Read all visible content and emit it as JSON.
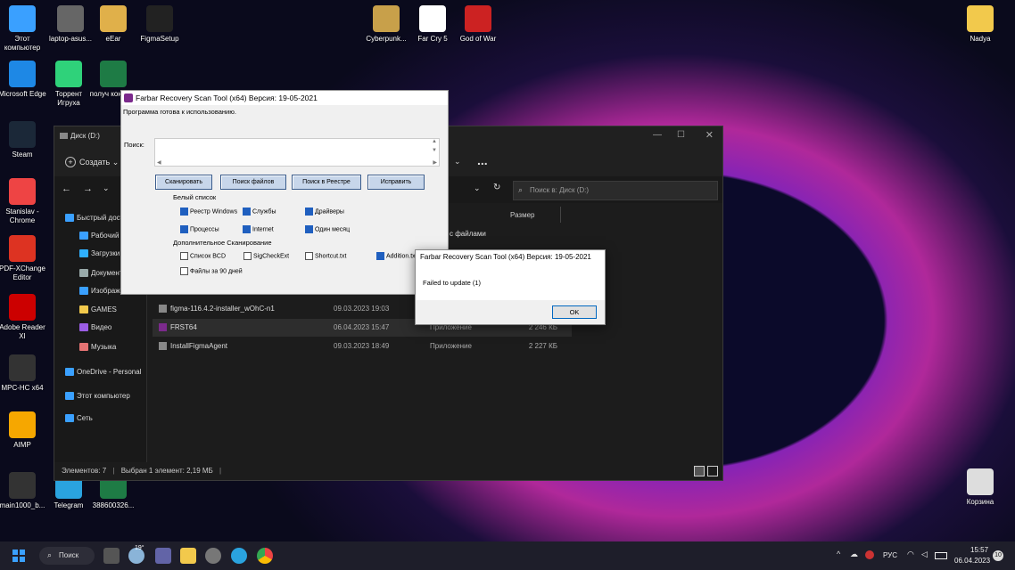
{
  "desktop": {
    "icons": [
      {
        "label": "Этот компьютер",
        "color": "#3aa0ff"
      },
      {
        "label": "laptop-asus...",
        "color": "#666"
      },
      {
        "label": "eEar",
        "color": "#e0b04a"
      },
      {
        "label": "FigmaSetup",
        "color": "#222"
      },
      {
        "label": "Cyberpunk...",
        "color": "#c8a04a"
      },
      {
        "label": "Far Cry 5",
        "color": "#fff"
      },
      {
        "label": "God of War",
        "color": "#c22"
      },
      {
        "label": "Nadya",
        "color": "#f2c94c"
      },
      {
        "label": "Microsoft Edge",
        "color": "#1e88e5"
      },
      {
        "label": "Торрент Игруха",
        "color": "#2fd27a"
      },
      {
        "label": "получ консуль",
        "color": "#1e7b45"
      },
      {
        "label": "Steam",
        "color": "#1b2838"
      },
      {
        "label": "Stanislav - Chrome",
        "color": "#e44"
      },
      {
        "label": "PDF-XChange Editor",
        "color": "#d32"
      },
      {
        "label": "Adobe Reader XI",
        "color": "#c00"
      },
      {
        "label": "MPC-HC x64",
        "color": "#333"
      },
      {
        "label": "AIMP",
        "color": "#f6a700"
      },
      {
        "label": "main1000_b...",
        "color": "#333"
      },
      {
        "label": "Telegram",
        "color": "#2aa3df"
      },
      {
        "label": "388600326...",
        "color": "#1e7b45"
      },
      {
        "label": "Корзина",
        "color": "#ddd"
      }
    ]
  },
  "explorer": {
    "title": "Диск (D:)",
    "create_label": "Создать",
    "more_label": "...",
    "search_placeholder": "Поиск в: Диск (D:)",
    "col_size": "Размер",
    "group_label": "с файлами",
    "nav": [
      {
        "label": "Быстрый доступ"
      },
      {
        "label": "Рабочий стол"
      },
      {
        "label": "Загрузки"
      },
      {
        "label": "Документы"
      },
      {
        "label": "Изображения"
      },
      {
        "label": "GAMES"
      },
      {
        "label": "Видео"
      },
      {
        "label": "Музыка"
      },
      {
        "label": "OneDrive - Personal"
      },
      {
        "label": "Этот компьютер"
      },
      {
        "label": "Сеть"
      }
    ],
    "files": [
      {
        "name": "figma-116.4.2-installer_wOhC-n1",
        "date": "09.03.2023 19:03",
        "type": "",
        "size": ""
      },
      {
        "name": "FRST64",
        "date": "06.04.2023 15:47",
        "type": "Приложение",
        "size": "2 246 КБ"
      },
      {
        "name": "InstallFigmaAgent",
        "date": "09.03.2023 18:49",
        "type": "Приложение",
        "size": "2 227 КБ"
      }
    ],
    "status_count": "Элементов: 7",
    "status_selected": "Выбран 1 элемент: 2,19 МБ"
  },
  "frst": {
    "title": "Farbar Recovery Scan Tool (x64) Версия: 19-05-2021",
    "status": "Программа готова к использованию.",
    "search_label": "Поиск:",
    "btn_scan": "Сканировать",
    "btn_search_files": "Поиск файлов",
    "btn_search_registry": "Поиск в Реестре",
    "btn_fix": "Исправить",
    "whitelist_label": "Белый список",
    "wl": [
      {
        "label": "Реестр Windows"
      },
      {
        "label": "Службы"
      },
      {
        "label": "Драйверы"
      },
      {
        "label": "Процессы"
      },
      {
        "label": "Internet"
      },
      {
        "label": "Один месяц"
      }
    ],
    "extra_label": "Дополнительное Сканирование",
    "extra": [
      {
        "label": "Список BCD"
      },
      {
        "label": "SigCheckExt"
      },
      {
        "label": "Shortcut.txt"
      },
      {
        "label": "Addition.txt"
      },
      {
        "label": "Файлы за 90 дней"
      }
    ]
  },
  "dialog": {
    "title": "Farbar Recovery Scan Tool (x64) Версия: 19-05-2021",
    "message": "Failed to update (1)",
    "ok_label": "OK"
  },
  "taskbar": {
    "search_label": "Поиск",
    "weather": "19°",
    "lang": "РУС",
    "time": "15:57",
    "date": "06.04.2023",
    "notif_count": "10"
  }
}
